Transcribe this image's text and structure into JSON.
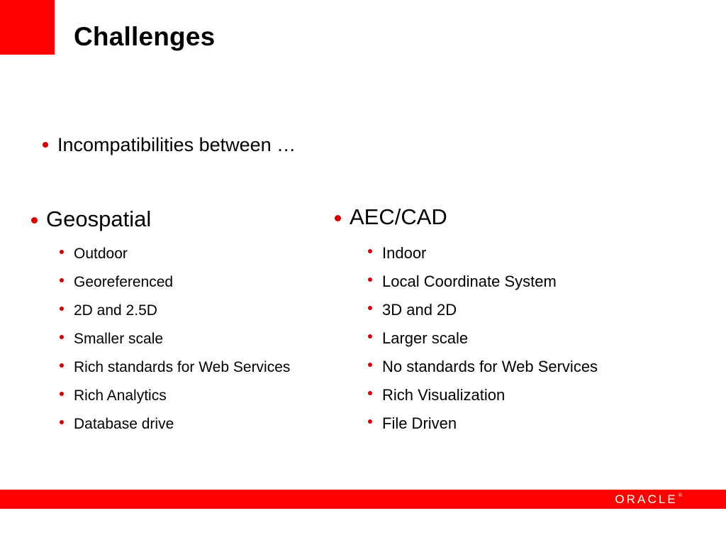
{
  "slide": {
    "title": "Challenges",
    "accent_color": "#FF0000",
    "bullet_color": "#D40000",
    "background_color": "#FFFFFF",
    "text_color": "#000000"
  },
  "lead_bullet": {
    "text": "Incompatibilities between …"
  },
  "columns": [
    {
      "heading": "Geospatial",
      "items": [
        "Outdoor",
        "Georeferenced",
        "2D and 2.5D",
        "Smaller scale",
        "Rich standards for Web Services",
        "Rich Analytics",
        "Database drive"
      ]
    },
    {
      "heading": "AEC/CAD",
      "items": [
        "Indoor",
        "Local Coordinate System",
        "3D and 2D",
        "Larger scale",
        "No standards for Web Services",
        "Rich Visualization",
        "File Driven"
      ]
    }
  ],
  "footer": {
    "logo_text": "ORACLE",
    "logo_trademark": "®",
    "bar_color": "#FF0000",
    "logo_color": "#FFFFFF"
  }
}
